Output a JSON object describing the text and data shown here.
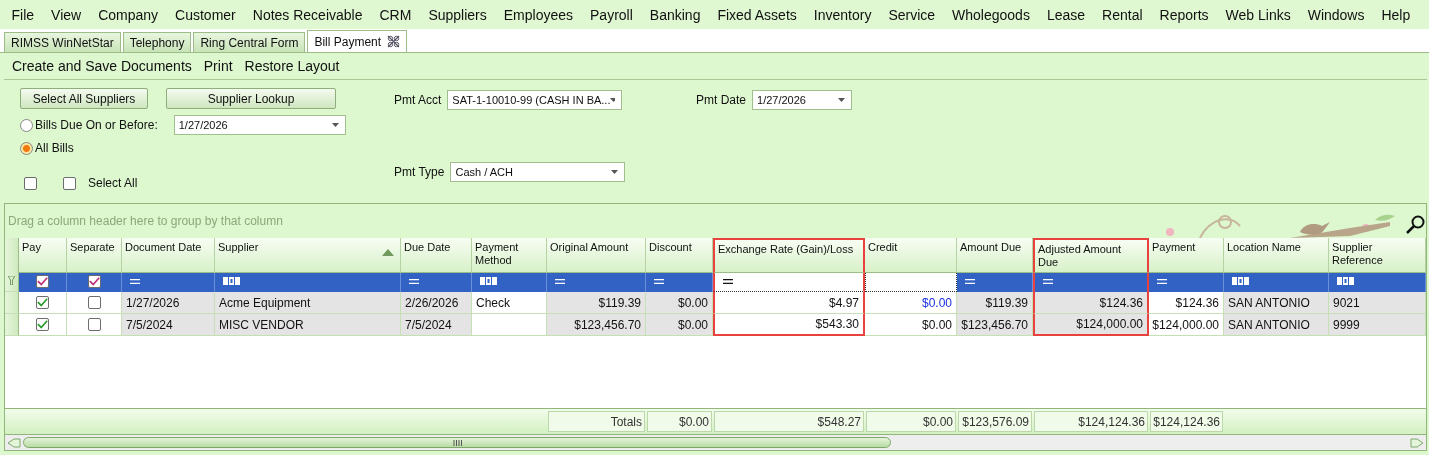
{
  "menu": [
    "File",
    "View",
    "Company",
    "Customer",
    "Notes Receivable",
    "CRM",
    "Suppliers",
    "Employees",
    "Payroll",
    "Banking",
    "Fixed Assets",
    "Inventory",
    "Service",
    "Wholegoods",
    "Lease",
    "Rental",
    "Reports",
    "Web Links",
    "Windows",
    "Help"
  ],
  "tabs": [
    {
      "label": "RIMSS WinNetStar",
      "selected": false
    },
    {
      "label": "Telephony",
      "selected": false
    },
    {
      "label": "Ring Central Form",
      "selected": false
    },
    {
      "label": "Bill Payment",
      "selected": true
    }
  ],
  "toolbar": [
    "Create and Save Documents",
    "Print",
    "Restore Layout"
  ],
  "form": {
    "buttons": [
      "Select All Suppliers",
      "Supplier Lookup"
    ],
    "radios": [
      {
        "label": "Bills Due On or Before:",
        "selected": false
      },
      {
        "label": "All Bills",
        "selected": true
      }
    ],
    "due_date": {
      "value": "1/27/2026"
    },
    "checkboxes": [
      {
        "checked": false
      },
      {
        "label": "Select All",
        "checked": false
      }
    ],
    "pmt_acct": {
      "label": "Pmt Acct",
      "value": "SAT-1-10010-99 (CASH IN BA..."
    },
    "pmt_date": {
      "label": "Pmt Date",
      "value": "1/27/2026"
    },
    "pmt_type": {
      "label": "Pmt Type",
      "value": "Cash / ACH"
    }
  },
  "table": {
    "group_hint": "Drag a column header here to group by that column",
    "columns": [
      {
        "label": "Pay",
        "filter": {
          "kind": "check",
          "editing": false
        },
        "highlighted": false,
        "sorted": false
      },
      {
        "label": "Separate",
        "filter": {
          "kind": "check",
          "editing": false
        },
        "highlighted": false,
        "sorted": false
      },
      {
        "label": "Document Date",
        "filter": {
          "kind": "equals",
          "editing": false
        },
        "highlighted": false,
        "sorted": false
      },
      {
        "label": "Supplier",
        "filter": {
          "kind": "text",
          "editing": false
        },
        "highlighted": false,
        "sorted": true
      },
      {
        "label": "Due Date",
        "filter": {
          "kind": "equals",
          "editing": false
        },
        "highlighted": false,
        "sorted": false
      },
      {
        "label": "Payment Method",
        "filter": {
          "kind": "text",
          "editing": false
        },
        "highlighted": false,
        "sorted": false
      },
      {
        "label": "Original Amount",
        "filter": {
          "kind": "equals",
          "editing": false
        },
        "highlighted": false,
        "sorted": false,
        "total": "Totals"
      },
      {
        "label": "Discount",
        "filter": {
          "kind": "equals",
          "editing": false
        },
        "highlighted": false,
        "sorted": false,
        "total": "$0.00"
      },
      {
        "label": "Exchange Rate (Gain)/Loss",
        "filter": {
          "kind": "equals",
          "editing": true
        },
        "highlighted": true,
        "sorted": false,
        "total": "$548.27"
      },
      {
        "label": "Credit",
        "filter": {
          "kind": "empty",
          "editing": true
        },
        "highlighted": false,
        "sorted": false,
        "total": "$0.00"
      },
      {
        "label": "Amount Due",
        "filter": {
          "kind": "equals",
          "editing": false
        },
        "highlighted": false,
        "sorted": false,
        "total": "$123,576.09"
      },
      {
        "label": "Adjusted Amount Due",
        "filter": {
          "kind": "equals",
          "editing": false
        },
        "highlighted": true,
        "sorted": false,
        "total": "$124,124.36"
      },
      {
        "label": "Payment",
        "filter": {
          "kind": "equals",
          "editing": false
        },
        "highlighted": false,
        "sorted": false,
        "total": "$124,124.36"
      },
      {
        "label": "Location Name",
        "filter": {
          "kind": "text",
          "editing": false
        },
        "highlighted": false,
        "sorted": false
      },
      {
        "label": "Supplier Reference",
        "filter": {
          "kind": "text",
          "editing": false
        },
        "highlighted": false,
        "sorted": false
      }
    ],
    "rows": [
      {
        "cells": [
          {
            "kind": "check",
            "checked": true
          },
          {
            "kind": "check",
            "checked": false
          },
          {
            "kind": "text",
            "text": "1/27/2026",
            "shaded": true,
            "edited": false
          },
          {
            "kind": "text",
            "text": "Acme Equipment",
            "shaded": true,
            "edited": false
          },
          {
            "kind": "text",
            "text": "2/26/2026",
            "shaded": true,
            "edited": false
          },
          {
            "kind": "text",
            "text": "Check",
            "shaded": false,
            "edited": false
          },
          {
            "kind": "amount",
            "text": "$119.39",
            "shaded": true,
            "edited": false
          },
          {
            "kind": "amount",
            "text": "$0.00",
            "shaded": true,
            "edited": false
          },
          {
            "kind": "amount",
            "text": "$4.97",
            "shaded": false,
            "edited": false
          },
          {
            "kind": "amount",
            "text": "$0.00",
            "shaded": false,
            "edited": true
          },
          {
            "kind": "amount",
            "text": "$119.39",
            "shaded": true,
            "edited": false
          },
          {
            "kind": "amount",
            "text": "$124.36",
            "shaded": true,
            "edited": false
          },
          {
            "kind": "amount",
            "text": "$124.36",
            "shaded": false,
            "edited": false
          },
          {
            "kind": "text",
            "text": "SAN ANTONIO",
            "shaded": true,
            "edited": false
          },
          {
            "kind": "text",
            "text": "9021",
            "shaded": true,
            "edited": false
          }
        ]
      },
      {
        "cells": [
          {
            "kind": "check",
            "checked": true
          },
          {
            "kind": "check",
            "checked": false
          },
          {
            "kind": "text",
            "text": "7/5/2024",
            "shaded": true,
            "edited": false
          },
          {
            "kind": "text",
            "text": "MISC VENDOR",
            "shaded": true,
            "edited": false
          },
          {
            "kind": "text",
            "text": "7/5/2024",
            "shaded": true,
            "edited": false
          },
          {
            "kind": "blank",
            "shaded": false
          },
          {
            "kind": "amount",
            "text": "$123,456.70",
            "shaded": true,
            "edited": false
          },
          {
            "kind": "amount",
            "text": "$0.00",
            "shaded": true,
            "edited": false
          },
          {
            "kind": "amount",
            "text": "$543.30",
            "shaded": false,
            "edited": false
          },
          {
            "kind": "amount",
            "text": "$0.00",
            "shaded": false,
            "edited": false
          },
          {
            "kind": "amount",
            "text": "$123,456.70",
            "shaded": true,
            "edited": false
          },
          {
            "kind": "amount",
            "text": "$124,000.00",
            "shaded": true,
            "edited": false
          },
          {
            "kind": "amount",
            "text": "$124,000.00",
            "shaded": false,
            "edited": false
          },
          {
            "kind": "text",
            "text": "SAN ANTONIO",
            "shaded": true,
            "edited": false
          },
          {
            "kind": "text",
            "text": "9999",
            "shaded": true,
            "edited": false
          }
        ]
      }
    ]
  }
}
